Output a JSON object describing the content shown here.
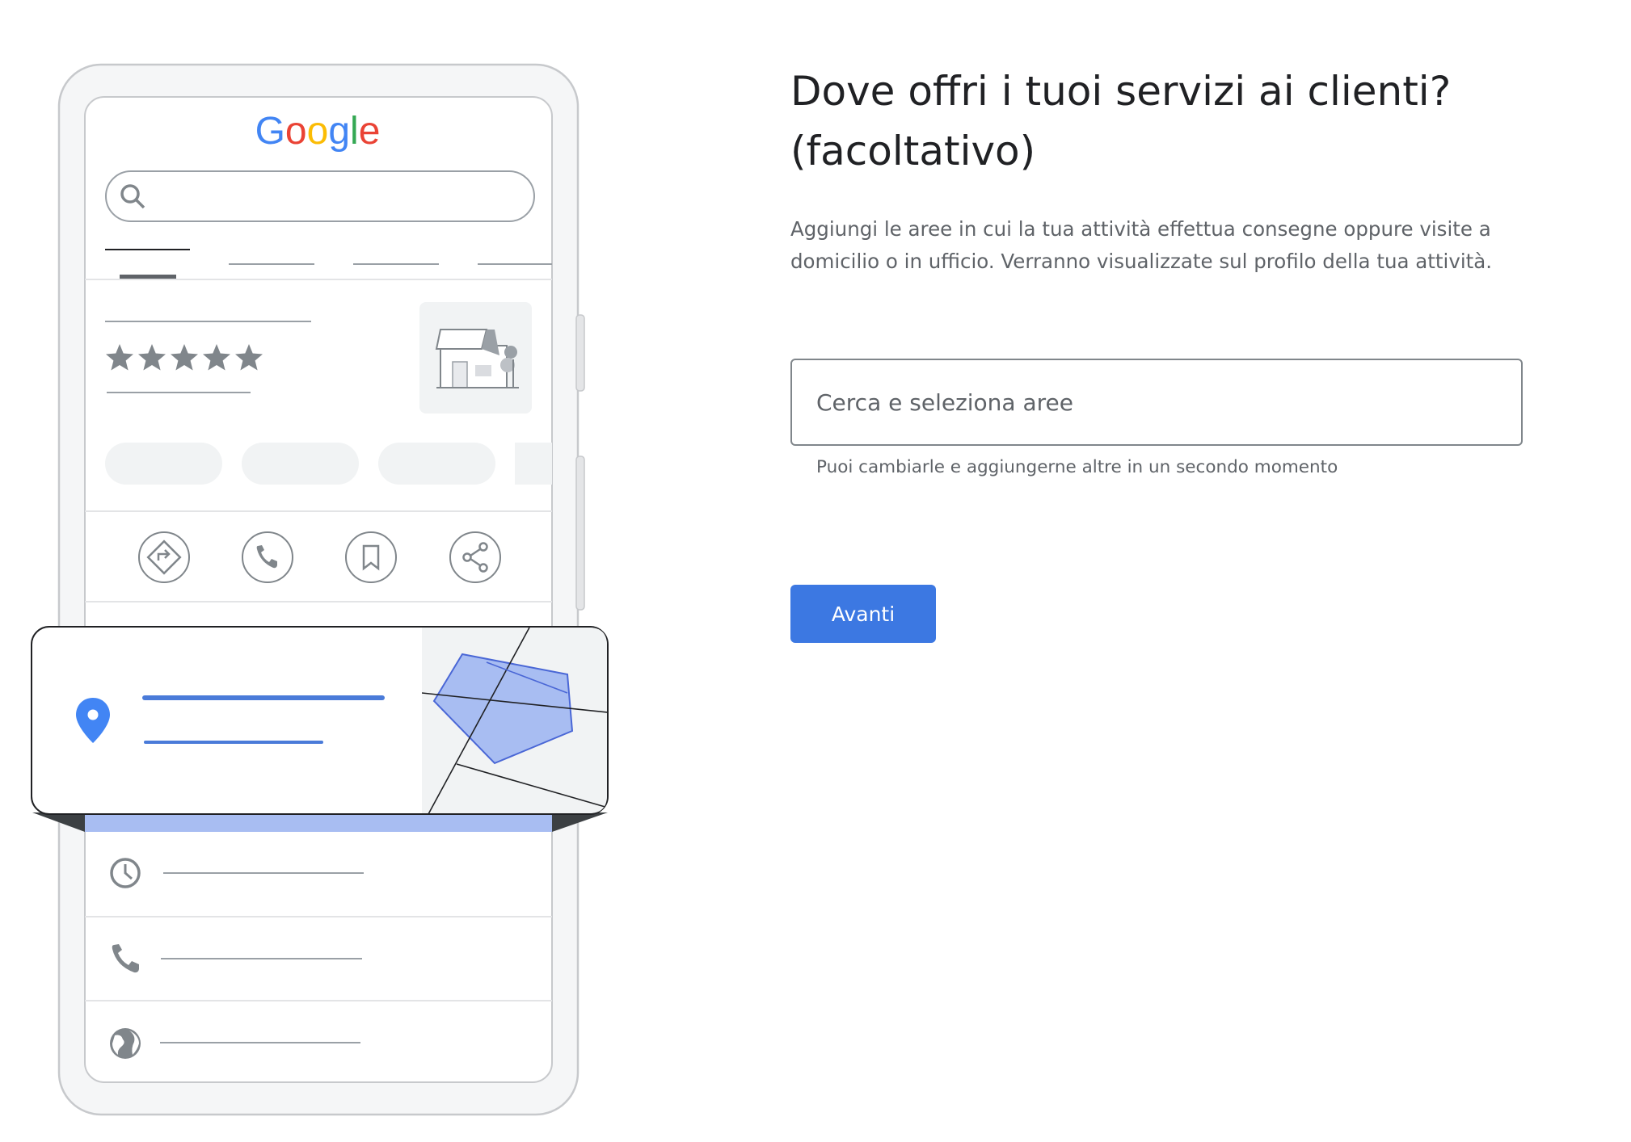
{
  "illustration": {
    "logo_text": "Google",
    "logo_colors": [
      "#4285F4",
      "#EA4335",
      "#FBBC05",
      "#4285F4",
      "#34A853",
      "#EA4335"
    ],
    "rating_stars": 5,
    "accent_color": "#4285F4",
    "area_fill_color": "#a8bdf2"
  },
  "form": {
    "title": "Dove offri i tuoi servizi ai clienti? (facoltativo)",
    "description": "Aggiungi le aree in cui la tua attività effettua consegne oppure visite a domicilio o in ufficio. Verranno visualizzate sul profilo della tua attività.",
    "search": {
      "placeholder": "Cerca e seleziona aree",
      "value": ""
    },
    "helper_text": "Puoi cambiarle e aggiungerne altre in un secondo momento",
    "next_label": "Avanti",
    "button_color": "#3c78e2"
  }
}
